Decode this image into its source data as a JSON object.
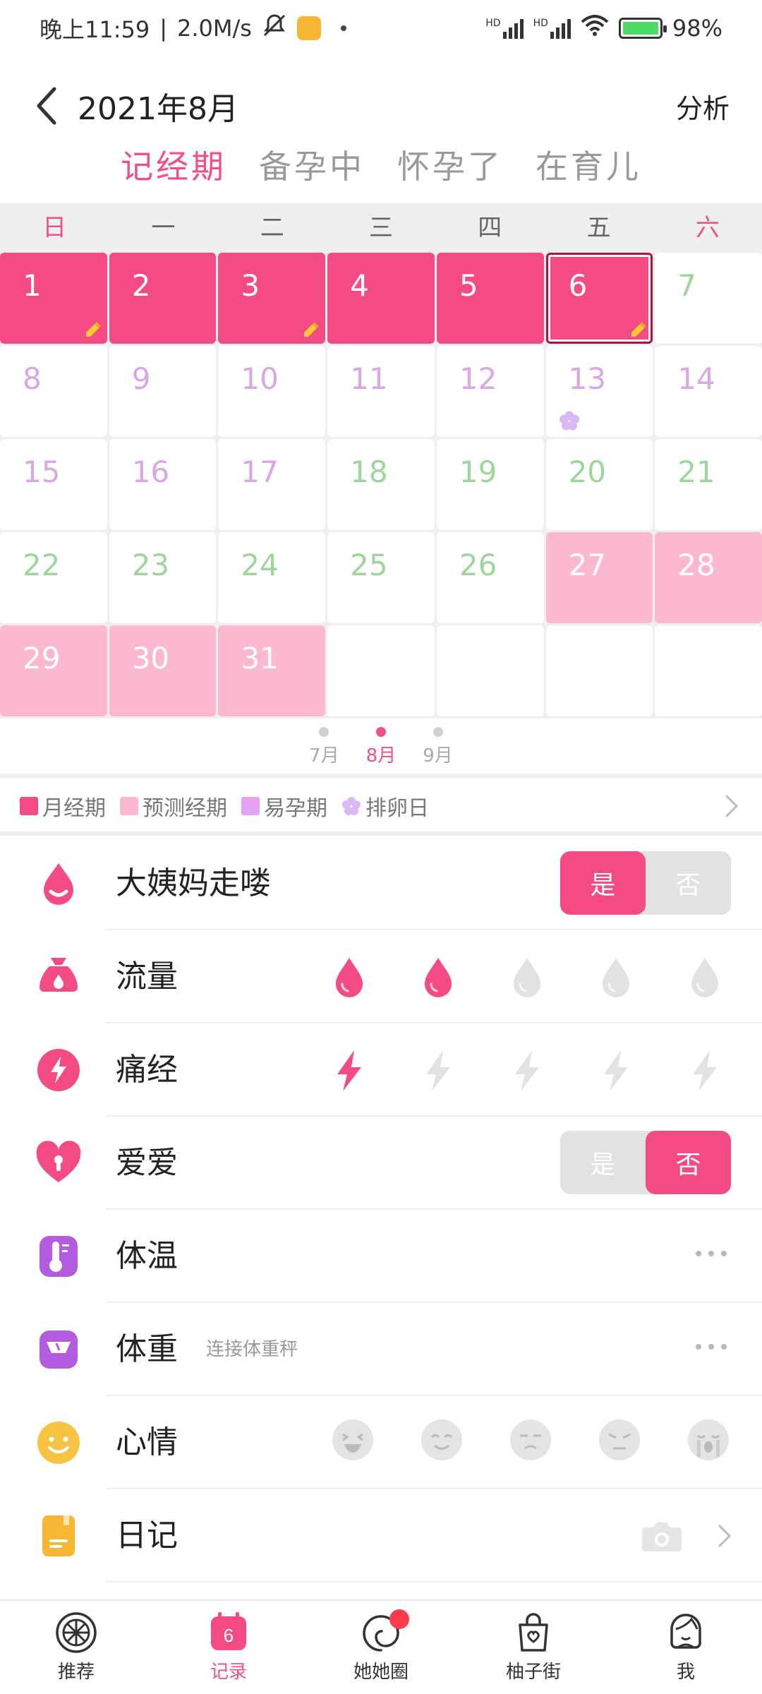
{
  "status_bar": {
    "time": "晚上11:59",
    "speed": "2.0M/s",
    "battery": "98%",
    "net1": "HD",
    "net2": "HD"
  },
  "header": {
    "title": "2021年8月",
    "right_action": "分析"
  },
  "mode_tabs": [
    {
      "label": "记经期",
      "active": true
    },
    {
      "label": "备孕中",
      "active": false
    },
    {
      "label": "怀孕了",
      "active": false
    },
    {
      "label": "在育儿",
      "active": false
    }
  ],
  "weekdays": [
    "日",
    "一",
    "二",
    "三",
    "四",
    "五",
    "六"
  ],
  "calendar": {
    "days": [
      {
        "d": "1",
        "type": "period",
        "tag": true
      },
      {
        "d": "2",
        "type": "period"
      },
      {
        "d": "3",
        "type": "period",
        "tag": true
      },
      {
        "d": "4",
        "type": "period"
      },
      {
        "d": "5",
        "type": "period"
      },
      {
        "d": "6",
        "type": "period",
        "tag": true,
        "selected": true
      },
      {
        "d": "7",
        "type": "safe"
      },
      {
        "d": "8",
        "type": "fertile"
      },
      {
        "d": "9",
        "type": "fertile"
      },
      {
        "d": "10",
        "type": "fertile"
      },
      {
        "d": "11",
        "type": "fertile"
      },
      {
        "d": "12",
        "type": "fertile"
      },
      {
        "d": "13",
        "type": "fertile",
        "ovulation": true
      },
      {
        "d": "14",
        "type": "fertile"
      },
      {
        "d": "15",
        "type": "fertile"
      },
      {
        "d": "16",
        "type": "fertile"
      },
      {
        "d": "17",
        "type": "fertile"
      },
      {
        "d": "18",
        "type": "safe"
      },
      {
        "d": "19",
        "type": "safe"
      },
      {
        "d": "20",
        "type": "safe"
      },
      {
        "d": "21",
        "type": "safe"
      },
      {
        "d": "22",
        "type": "safe"
      },
      {
        "d": "23",
        "type": "safe"
      },
      {
        "d": "24",
        "type": "safe"
      },
      {
        "d": "25",
        "type": "safe"
      },
      {
        "d": "26",
        "type": "safe"
      },
      {
        "d": "27",
        "type": "predict"
      },
      {
        "d": "28",
        "type": "predict"
      },
      {
        "d": "29",
        "type": "predict"
      },
      {
        "d": "30",
        "type": "predict"
      },
      {
        "d": "31",
        "type": "predict"
      },
      {
        "d": "",
        "type": "empty"
      },
      {
        "d": "",
        "type": "empty"
      },
      {
        "d": "",
        "type": "empty"
      },
      {
        "d": "",
        "type": "empty"
      }
    ]
  },
  "month_switch": [
    {
      "label": "7月",
      "active": false
    },
    {
      "label": "8月",
      "active": true
    },
    {
      "label": "9月",
      "active": false
    }
  ],
  "legend": [
    {
      "label": "月经期",
      "color": "#f44b82",
      "shape": "square"
    },
    {
      "label": "预测经期",
      "color": "#fcb8cf",
      "shape": "square"
    },
    {
      "label": "易孕期",
      "color": "#e3a3f2",
      "shape": "square"
    },
    {
      "label": "排卵日",
      "color": "#d8b8f5",
      "shape": "flower"
    }
  ],
  "records": {
    "period_gone": {
      "label": "大姨妈走喽",
      "yes": "是",
      "no": "否",
      "selected": "yes"
    },
    "flow": {
      "label": "流量",
      "level": 2,
      "max": 5
    },
    "cramps": {
      "label": "痛经",
      "level": 1,
      "max": 5
    },
    "love": {
      "label": "爱爱",
      "yes": "是",
      "no": "否",
      "selected": "no"
    },
    "temperature": {
      "label": "体温"
    },
    "weight": {
      "label": "体重",
      "sub": "连接体重秤"
    },
    "mood": {
      "label": "心情"
    },
    "diary": {
      "label": "日记"
    }
  },
  "bottom_nav": [
    {
      "label": "推荐",
      "icon": "citrus-icon",
      "active": false
    },
    {
      "label": "记录",
      "icon": "calendar-icon",
      "active": true,
      "badge_text": "6"
    },
    {
      "label": "她她圈",
      "icon": "swirl-icon",
      "active": false,
      "dot": true
    },
    {
      "label": "柚子街",
      "icon": "bag-icon",
      "active": false
    },
    {
      "label": "我",
      "icon": "girl-icon",
      "active": false
    }
  ],
  "colors": {
    "accent": "#f0508a",
    "period": "#f44b82",
    "predict": "#fcb8cf",
    "fertile_text": "#d9a6e6",
    "safe_text": "#9dd69a"
  }
}
